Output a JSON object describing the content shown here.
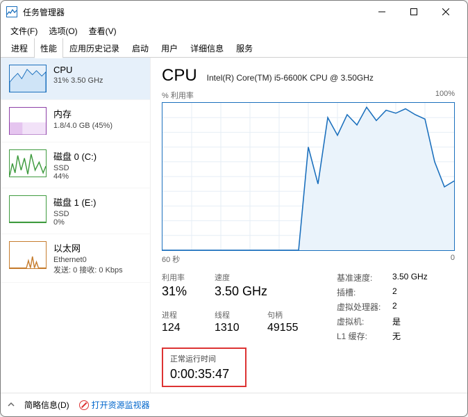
{
  "window": {
    "title": "任务管理器"
  },
  "menus": {
    "file": "文件(F)",
    "options": "选项(O)",
    "view": "查看(V)"
  },
  "tabs": {
    "processes": "进程",
    "performance": "性能",
    "apphistory": "应用历史记录",
    "startup": "启动",
    "users": "用户",
    "details": "详细信息",
    "services": "服务"
  },
  "sidebar": {
    "items": [
      {
        "name": "CPU",
        "detail": "31% 3.50 GHz"
      },
      {
        "name": "内存",
        "detail": "1.8/4.0 GB (45%)"
      },
      {
        "name": "磁盘 0 (C:)",
        "detail_a": "SSD",
        "detail_b": "44%"
      },
      {
        "name": "磁盘 1 (E:)",
        "detail_a": "SSD",
        "detail_b": "0%"
      },
      {
        "name": "以太网",
        "detail_a": "Ethernet0",
        "detail_b": "发送: 0 接收: 0 Kbps"
      }
    ]
  },
  "main": {
    "title": "CPU",
    "subtitle": "Intel(R) Core(TM) i5-6600K CPU @ 3.50GHz",
    "chart_top_left": "% 利用率",
    "chart_top_right": "100%",
    "chart_bottom_left": "60 秒",
    "chart_bottom_right": "0",
    "stats": {
      "util_lbl": "利用率",
      "util_val": "31%",
      "speed_lbl": "速度",
      "speed_val": "3.50 GHz",
      "proc_lbl": "进程",
      "proc_val": "124",
      "thread_lbl": "线程",
      "thread_val": "1310",
      "handle_lbl": "句柄",
      "handle_val": "49155"
    },
    "right": {
      "base_lbl": "基准速度:",
      "base_val": "3.50 GHz",
      "sockets_lbl": "插槽:",
      "sockets_val": "2",
      "vproc_lbl": "虚拟处理器:",
      "vproc_val": "2",
      "vm_lbl": "虚拟机:",
      "vm_val": "是",
      "l1_lbl": "L1 缓存:",
      "l1_val": "无"
    },
    "uptime": {
      "lbl": "正常运行时间",
      "val": "0:00:35:47"
    }
  },
  "footer": {
    "brief": "简略信息(D)",
    "resmon": "打开资源监视器"
  },
  "chart_data": {
    "type": "area",
    "title": "% 利用率",
    "xlabel": "60 秒",
    "ylabel": "%",
    "ylim": [
      0,
      100
    ],
    "x_seconds_ago": [
      60,
      58,
      56,
      54,
      52,
      50,
      48,
      46,
      44,
      42,
      40,
      38,
      36,
      34,
      32,
      30,
      28,
      26,
      24,
      22,
      20,
      18,
      16,
      14,
      12,
      10,
      8,
      6,
      4,
      2,
      0
    ],
    "values": [
      0,
      0,
      0,
      0,
      0,
      0,
      0,
      0,
      0,
      0,
      0,
      0,
      0,
      0,
      0,
      70,
      45,
      90,
      78,
      92,
      85,
      97,
      88,
      95,
      93,
      96,
      92,
      89,
      60,
      43,
      47
    ]
  }
}
